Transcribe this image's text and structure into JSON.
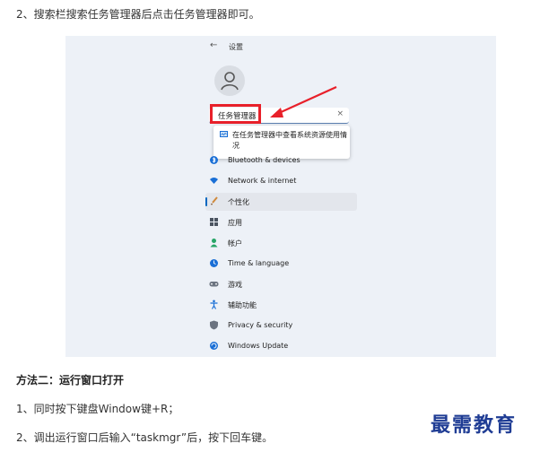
{
  "article": {
    "step2_top": "2、搜索栏搜索任务管理器后点击任务管理器即可。",
    "method2_title": "方法二：运行窗口打开",
    "method2_step1": "1、同时按下键盘Window键+R；",
    "method2_step2": "2、调出运行窗口后输入“taskmgr”后，按下回车键。"
  },
  "screenshot": {
    "back_label": "←",
    "title": "设置",
    "search_value": "任务管理器",
    "clear_label": "×",
    "suggestion": "在任务管理器中查看系统资源使用情况",
    "nav_items": [
      {
        "label": "Bluetooth & devices",
        "icon": "bluetooth-icon",
        "color": "#1a6fd6"
      },
      {
        "label": "Network & internet",
        "icon": "wifi-icon",
        "color": "#1a6fd6"
      },
      {
        "label": "个性化",
        "icon": "brush-icon",
        "color": "#d08a3c"
      },
      {
        "label": "应用",
        "icon": "apps-icon",
        "color": "#4a5360"
      },
      {
        "label": "帐户",
        "icon": "account-icon",
        "color": "#27a567"
      },
      {
        "label": "Time & language",
        "icon": "globe-clock-icon",
        "color": "#1a6fd6"
      },
      {
        "label": "游戏",
        "icon": "gamepad-icon",
        "color": "#6b7380"
      },
      {
        "label": "辅助功能",
        "icon": "accessibility-icon",
        "color": "#1a6fd6"
      },
      {
        "label": "Privacy & security",
        "icon": "shield-icon",
        "color": "#6b7380"
      },
      {
        "label": "Windows Update",
        "icon": "update-icon",
        "color": "#1a6fd6"
      }
    ],
    "highlight_color": "#e8202a"
  },
  "watermark": "最需教育"
}
